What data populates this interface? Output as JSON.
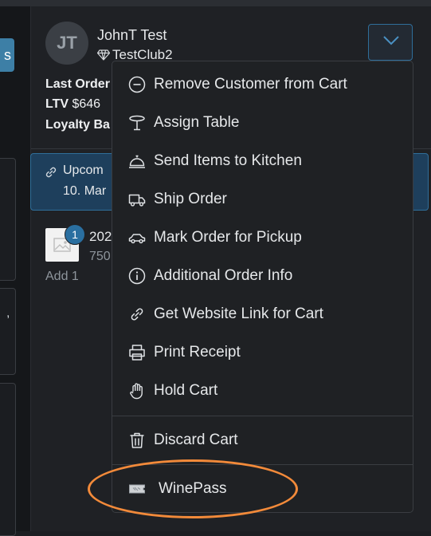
{
  "left": {
    "partial_button": "s",
    "partial_comma": ","
  },
  "customer": {
    "initials": "JT",
    "name": "JohnT Test",
    "club": "TestClub2",
    "last_order_label": "Last Order",
    "ltv_label": "LTV",
    "ltv_value": "$646",
    "loyalty_label": "Loyalty Ba"
  },
  "upcoming": {
    "title": "Upcom",
    "date": "10. Mar"
  },
  "cart_item": {
    "quantity": "1",
    "name": "202",
    "price": "750",
    "add_label": "Add 1"
  },
  "menu": {
    "items": [
      {
        "label": "Remove Customer from Cart",
        "icon": "minus-circle-icon"
      },
      {
        "label": "Assign Table",
        "icon": "table-icon"
      },
      {
        "label": "Send Items to Kitchen",
        "icon": "cloche-icon"
      },
      {
        "label": "Ship Order",
        "icon": "truck-icon"
      },
      {
        "label": "Mark Order for Pickup",
        "icon": "car-icon"
      },
      {
        "label": "Additional Order Info",
        "icon": "info-circle-icon"
      },
      {
        "label": "Get Website Link for Cart",
        "icon": "link-icon"
      },
      {
        "label": "Print Receipt",
        "icon": "printer-icon"
      },
      {
        "label": "Hold Cart",
        "icon": "hand-icon"
      }
    ],
    "discard": {
      "label": "Discard Cart",
      "icon": "trash-icon"
    },
    "winepass": {
      "label": "WinePass",
      "icon": "ticket-icon"
    }
  },
  "colors": {
    "accent": "#2f6e9a",
    "highlight": "#f28a3a",
    "menu_bg": "#1f2124"
  }
}
